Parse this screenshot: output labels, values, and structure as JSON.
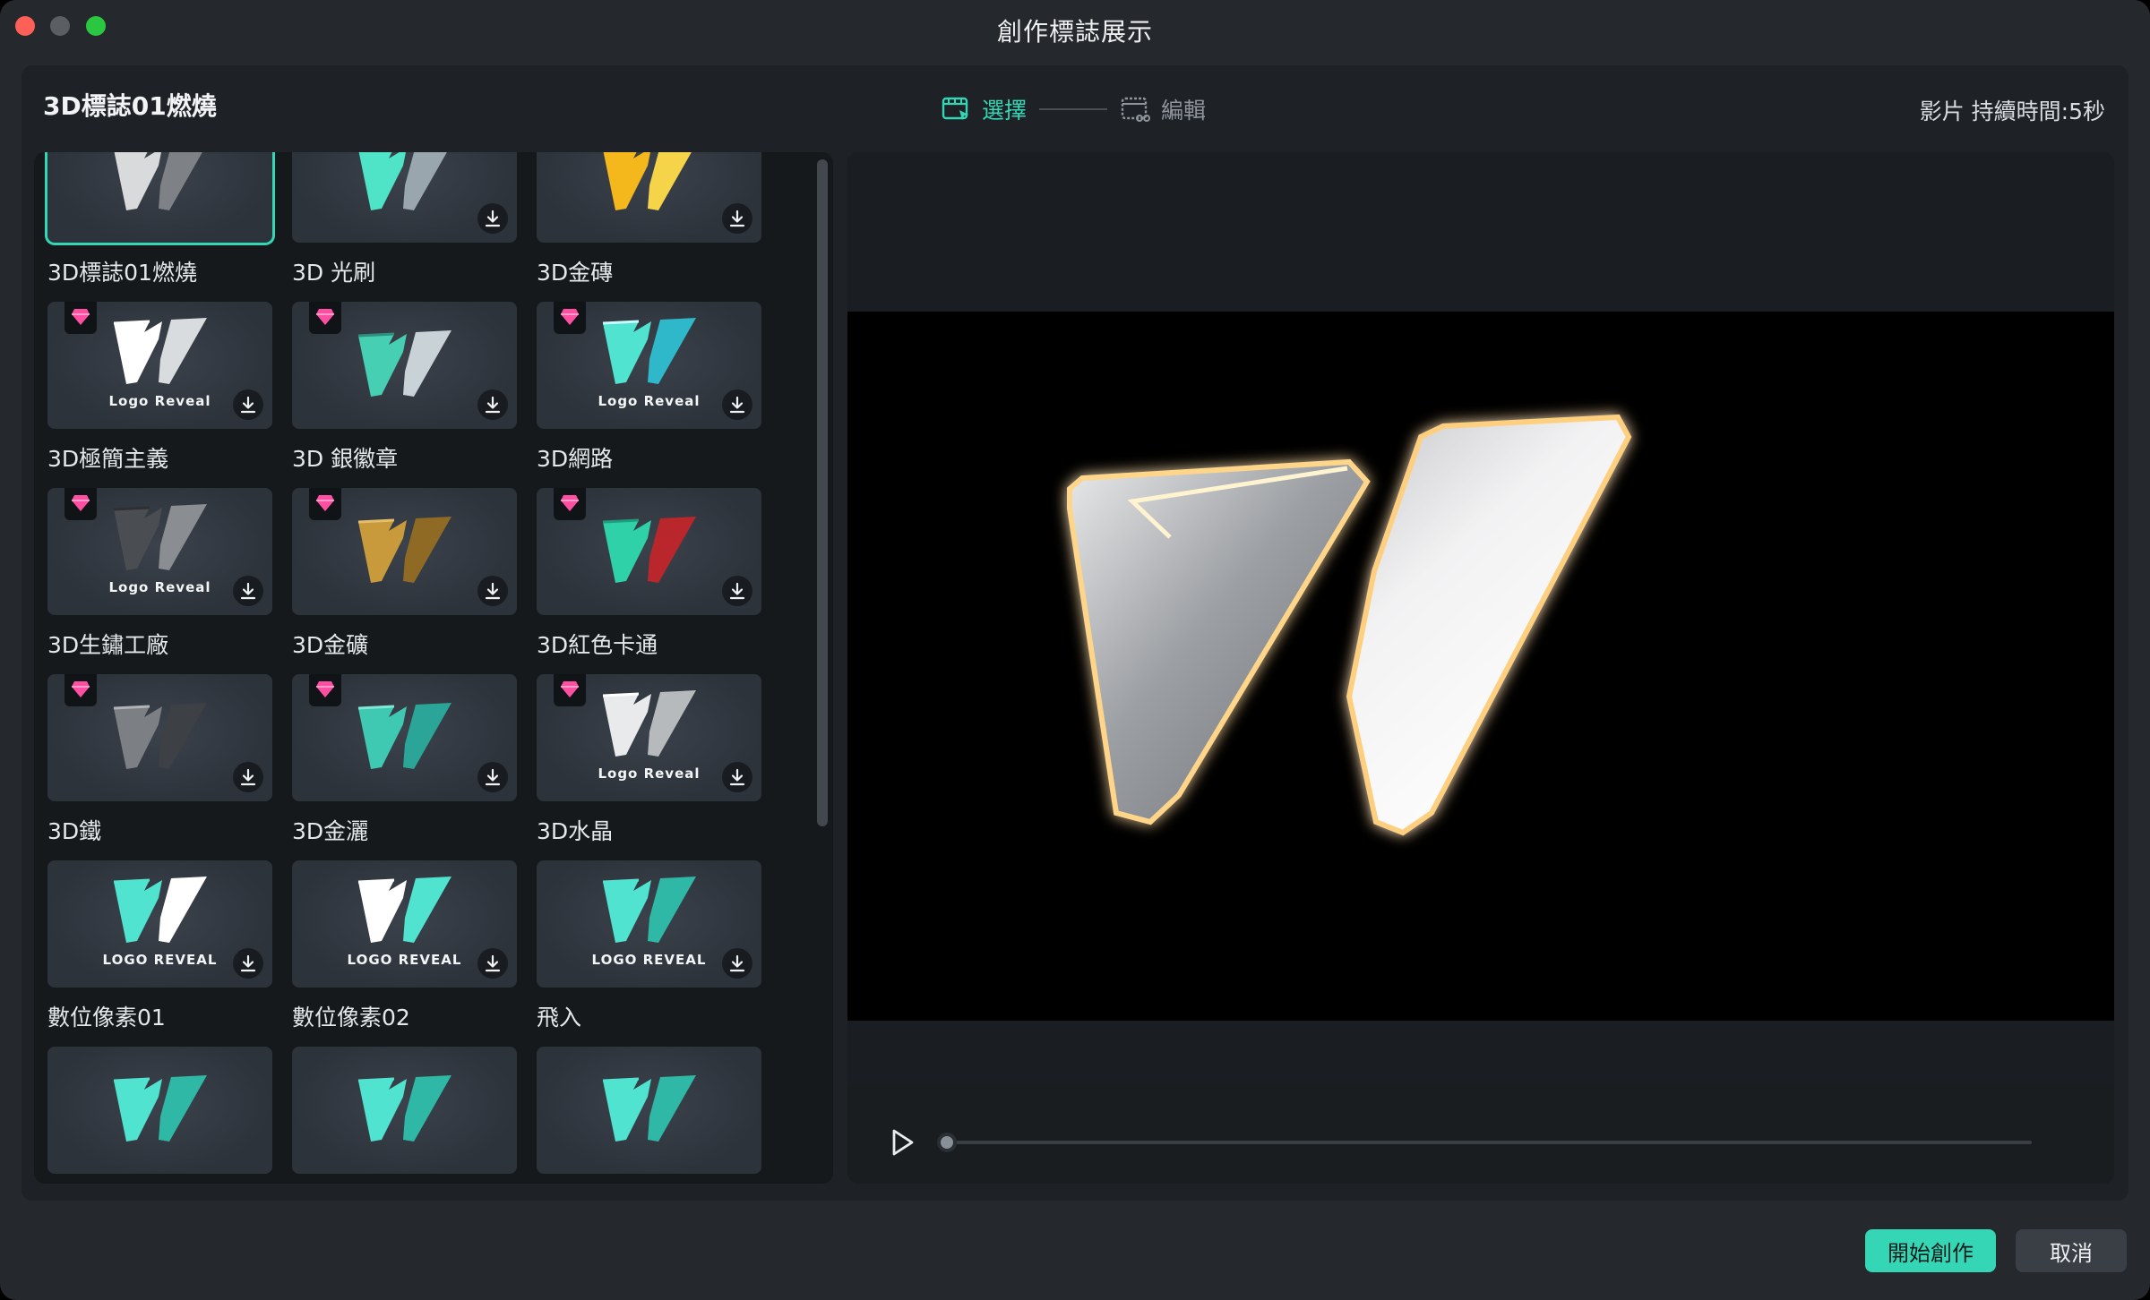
{
  "window": {
    "title": "創作標誌展示"
  },
  "header": {
    "template_name": "3D標誌01燃燒",
    "steps": [
      {
        "label": "選擇",
        "active": true
      },
      {
        "label": "編輯",
        "active": false
      }
    ],
    "duration": "影片 持續時間:5秒"
  },
  "templates": [
    {
      "label": "3D標誌01燃燒",
      "premium": true,
      "downloadable": false,
      "selected": true,
      "style": "silver"
    },
    {
      "label": "3D 光刷",
      "premium": true,
      "downloadable": true,
      "style": "teal-chrome"
    },
    {
      "label": "3D金磚",
      "premium": true,
      "downloadable": true,
      "style": "gold"
    },
    {
      "label": "3D極簡主義",
      "premium": true,
      "downloadable": true,
      "style": "white",
      "sub": "Logo Reveal"
    },
    {
      "label": "3D 銀徽章",
      "premium": true,
      "downloadable": true,
      "style": "teal-silver"
    },
    {
      "label": "3D網路",
      "premium": true,
      "downloadable": true,
      "style": "teal",
      "sub": "Logo Reveal"
    },
    {
      "label": "3D生鏽工廠",
      "premium": true,
      "downloadable": true,
      "style": "dark-metal",
      "sub": "Logo Reveal"
    },
    {
      "label": "3D金礦",
      "premium": true,
      "downloadable": true,
      "style": "gold-ore"
    },
    {
      "label": "3D紅色卡通",
      "premium": true,
      "downloadable": true,
      "style": "red-cartoon"
    },
    {
      "label": "3D鐵",
      "premium": true,
      "downloadable": true,
      "style": "iron"
    },
    {
      "label": "3D金灑",
      "premium": true,
      "downloadable": true,
      "style": "teal-glitter"
    },
    {
      "label": "3D水晶",
      "premium": true,
      "downloadable": true,
      "style": "crystal",
      "sub": "Logo Reveal"
    },
    {
      "label": "數位像素01",
      "premium": false,
      "downloadable": true,
      "style": "teal-flat",
      "sub": "LOGO REVEAL"
    },
    {
      "label": "數位像素02",
      "premium": false,
      "downloadable": true,
      "style": "white-flat",
      "sub": "LOGO REVEAL"
    },
    {
      "label": "飛入",
      "premium": false,
      "downloadable": true,
      "style": "teal-fly",
      "sub": "LOGO REVEAL"
    },
    {
      "label": "",
      "premium": false,
      "downloadable": false,
      "style": "teal-partial"
    },
    {
      "label": "",
      "premium": false,
      "downloadable": false,
      "style": "teal-partial"
    },
    {
      "label": "",
      "premium": false,
      "downloadable": false,
      "style": "teal-partial"
    }
  ],
  "player": {
    "progress": 0.0
  },
  "footer": {
    "primary_label": "開始創作",
    "secondary_label": "取消"
  },
  "colors": {
    "accent": "#35d6b6",
    "premium_gem": "#ff4fa3",
    "background": "#25282c"
  }
}
